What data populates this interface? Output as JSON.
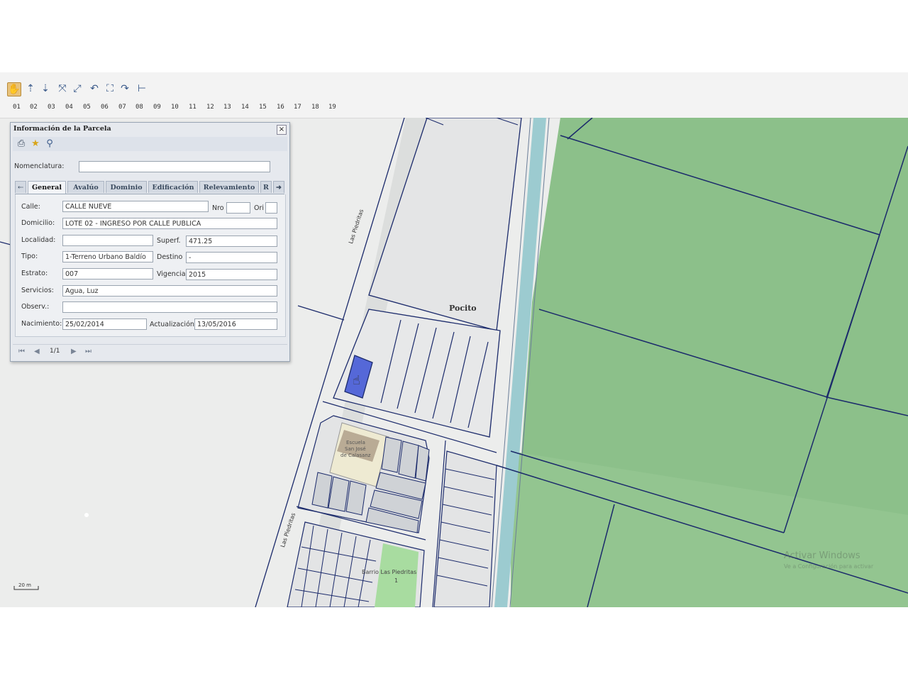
{
  "toolbar": {
    "tools": [
      "hand-icon",
      "zoom-in-icon",
      "zoom-out-icon",
      "zoom-extent-icon",
      "full-extent-icon",
      "undo-icon",
      "zoom-box-icon",
      "redo-icon",
      "measure-icon"
    ],
    "levels": [
      "01",
      "02",
      "03",
      "04",
      "05",
      "06",
      "07",
      "08",
      "09",
      "10",
      "11",
      "12",
      "13",
      "14",
      "15",
      "16",
      "17",
      "18",
      "19"
    ]
  },
  "panel": {
    "title": "Información de la Parcela",
    "close_label": "×",
    "tools": [
      "print-icon",
      "star-icon",
      "search-icon"
    ],
    "nomenclatura_label": "Nomenclatura:",
    "nomenclatura_value": "",
    "tabs": [
      "General",
      "Avalúo",
      "Dominio",
      "Edificación",
      "Relevamiento",
      "R"
    ],
    "tab_prev": "⇠",
    "tab_next": "➜",
    "fields": {
      "calle_label": "Calle:",
      "calle_value": "CALLE NUEVE",
      "nro_label": "Nro",
      "nro_value": "",
      "ori_label": "Ori",
      "ori_value": "",
      "domicilio_label": "Domicilio:",
      "domicilio_value": "LOTE 02 - INGRESO POR CALLE PUBLICA",
      "localidad_label": "Localidad:",
      "localidad_value": "",
      "superf_label": "Superf.",
      "superf_value": "471.25",
      "tipo_label": "Tipo:",
      "tipo_value": "1-Terreno Urbano Baldío",
      "destino_label": "Destino",
      "destino_value": "-",
      "estrato_label": "Estrato:",
      "estrato_value": "007",
      "vigencia_label": "Vigencia",
      "vigencia_value": "2015",
      "servicios_label": "Servicios:",
      "servicios_value": "Agua, Luz",
      "observ_label": "Observ.:",
      "observ_value": "",
      "nacimiento_label": "Nacimiento:",
      "nacimiento_value": "25/02/2014",
      "actualizacion_label": "Actualización",
      "actualizacion_value": "13/05/2016"
    },
    "pager": {
      "first": "⏮",
      "prev": "◀",
      "page": "1/1",
      "next": "▶",
      "last": "⏭"
    }
  },
  "map": {
    "district_label": "Pocito",
    "street_label_1": "Las Piedritas",
    "street_label_2": "Las Piedritas",
    "school_label_1": "Escuela",
    "school_label_2": "San José",
    "school_label_3": "de Calasanz",
    "neighborhood_label": "Barrio Las Piedritas",
    "neighborhood_sub": "1",
    "scale_label": "20 m",
    "watermark_1": "Activar Windows",
    "watermark_2": "Ve a Configuración para activar"
  },
  "colors": {
    "field_green": "#8cc08a",
    "selected_parcel": "#5568d8",
    "lot_gray": "#cfd2d6",
    "canal": "#9ccbd0",
    "parcel_line": "#1b2a6b"
  }
}
